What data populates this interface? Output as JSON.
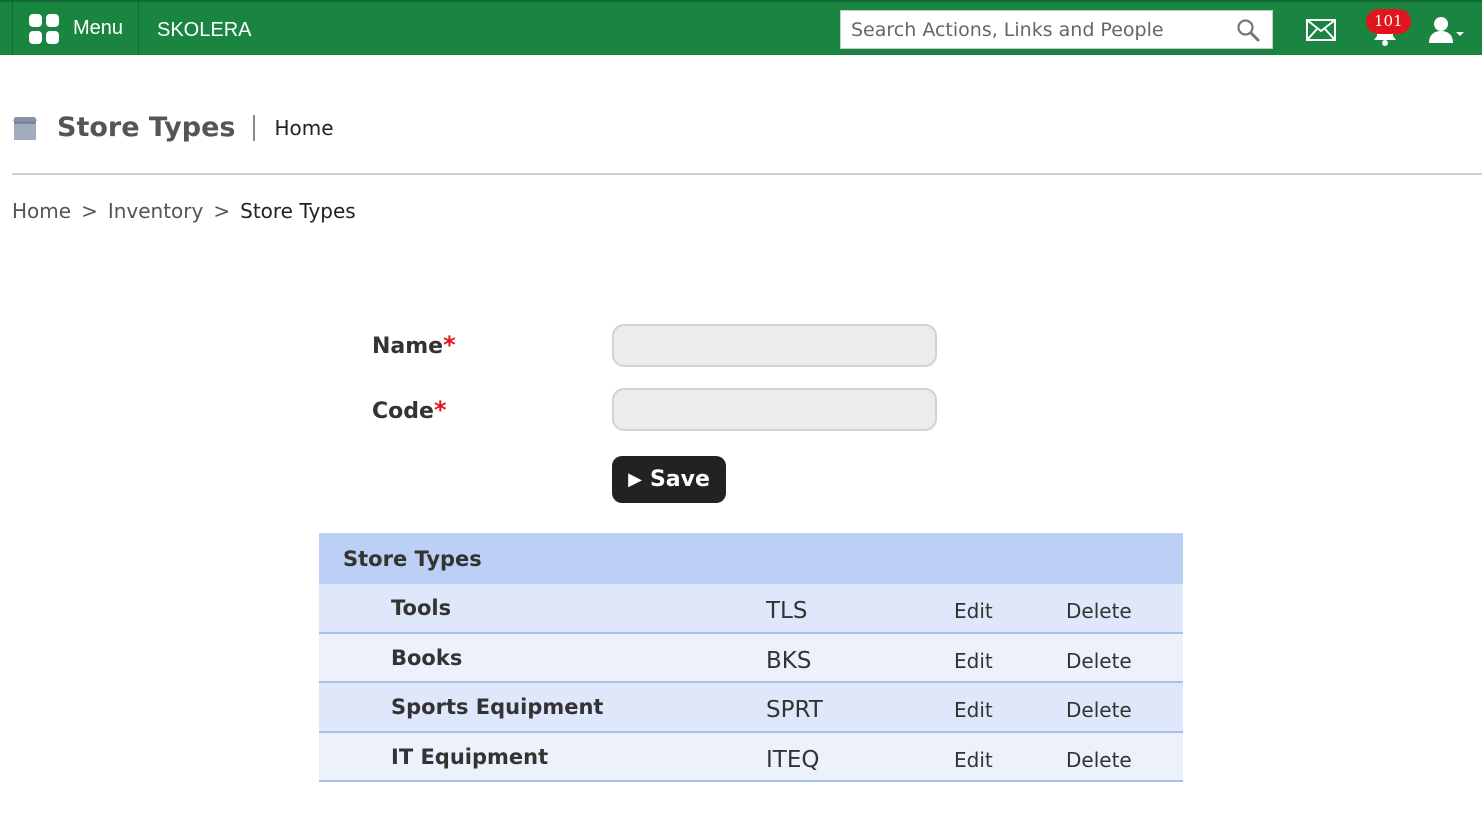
{
  "topbar": {
    "menu_label": "Menu",
    "brand": "SKOLERA",
    "search_placeholder": "Search Actions, Links and People",
    "notification_count": "101",
    "bg_color": "#1a8541",
    "icons": [
      "grid-icon",
      "search-icon",
      "mail-icon",
      "bell-icon",
      "user-icon"
    ]
  },
  "header": {
    "title": "Store Types",
    "home_label": "Home",
    "icon": "store-icon"
  },
  "breadcrumb": {
    "items": [
      "Home",
      "Inventory",
      "Store Types"
    ],
    "separator": ">"
  },
  "form": {
    "name_label": "Name",
    "code_label": "Code",
    "required_mark": "*",
    "name_value": "",
    "code_value": "",
    "save_label": "Save"
  },
  "table": {
    "title": "Store Types",
    "rows": [
      {
        "name": "Tools",
        "code": "TLS",
        "edit": "Edit",
        "delete": "Delete"
      },
      {
        "name": "Books",
        "code": "BKS",
        "edit": "Edit",
        "delete": "Delete"
      },
      {
        "name": "Sports Equipment",
        "code": "SPRT",
        "edit": "Edit",
        "delete": "Delete"
      },
      {
        "name": "IT Equipment",
        "code": "ITEQ",
        "edit": "Edit",
        "delete": "Delete"
      }
    ]
  }
}
